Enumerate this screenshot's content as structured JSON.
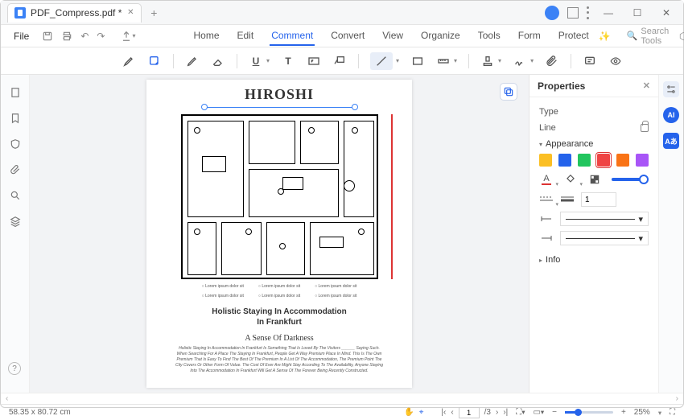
{
  "titlebar": {
    "tab_title": "PDF_Compress.pdf *"
  },
  "menubar": {
    "file": "File",
    "items": [
      "Home",
      "Edit",
      "Comment",
      "Convert",
      "View",
      "Organize",
      "Tools",
      "Form",
      "Protect"
    ],
    "active_index": 2,
    "search_placeholder": "Search Tools"
  },
  "document": {
    "title": "HIROSHI",
    "notes": [
      "Lorem ipsum dolor sit",
      "Lorem ipsum dolor sit",
      "Lorem ipsum dolor sit"
    ],
    "subtitle_line1": "Holistic Staying In Accommodation",
    "subtitle_line2": "In Frankfurt",
    "script_title": "A Sense Of Darkness",
    "body": "Holistic Staying In Accommodation In Frankfurt Is Something That Is Loved By The Visitors ______ Saying Such. When Searching For A Place The Staying In Frankfurt, People Get A Way Premium Place In Mind. This Is The Own Premium That Is Easy To Find The Best Of The Premium In A List Of The Accommodation, The Premium Point The City Covers Or Other Form Of Value. The Cost Of Ever Are Might Stay According To The Availability, Anyone Staying Into The Accommodation In Frankfurt Will Get A Sense Of The Forever Being Recently Constructed."
  },
  "properties": {
    "panel_title": "Properties",
    "type_label": "Type",
    "type_value": "Line",
    "appearance_label": "Appearance",
    "colors": [
      "#fbbf24",
      "#2563eb",
      "#22c55e",
      "#ef4444",
      "#f97316",
      "#a855f7"
    ],
    "selected_color_index": 3,
    "thickness_value": "1",
    "info_label": "Info"
  },
  "statusbar": {
    "dimensions": "58.35 x 80.72 cm",
    "page_current": "1",
    "page_total": "/3",
    "zoom": "25%"
  }
}
